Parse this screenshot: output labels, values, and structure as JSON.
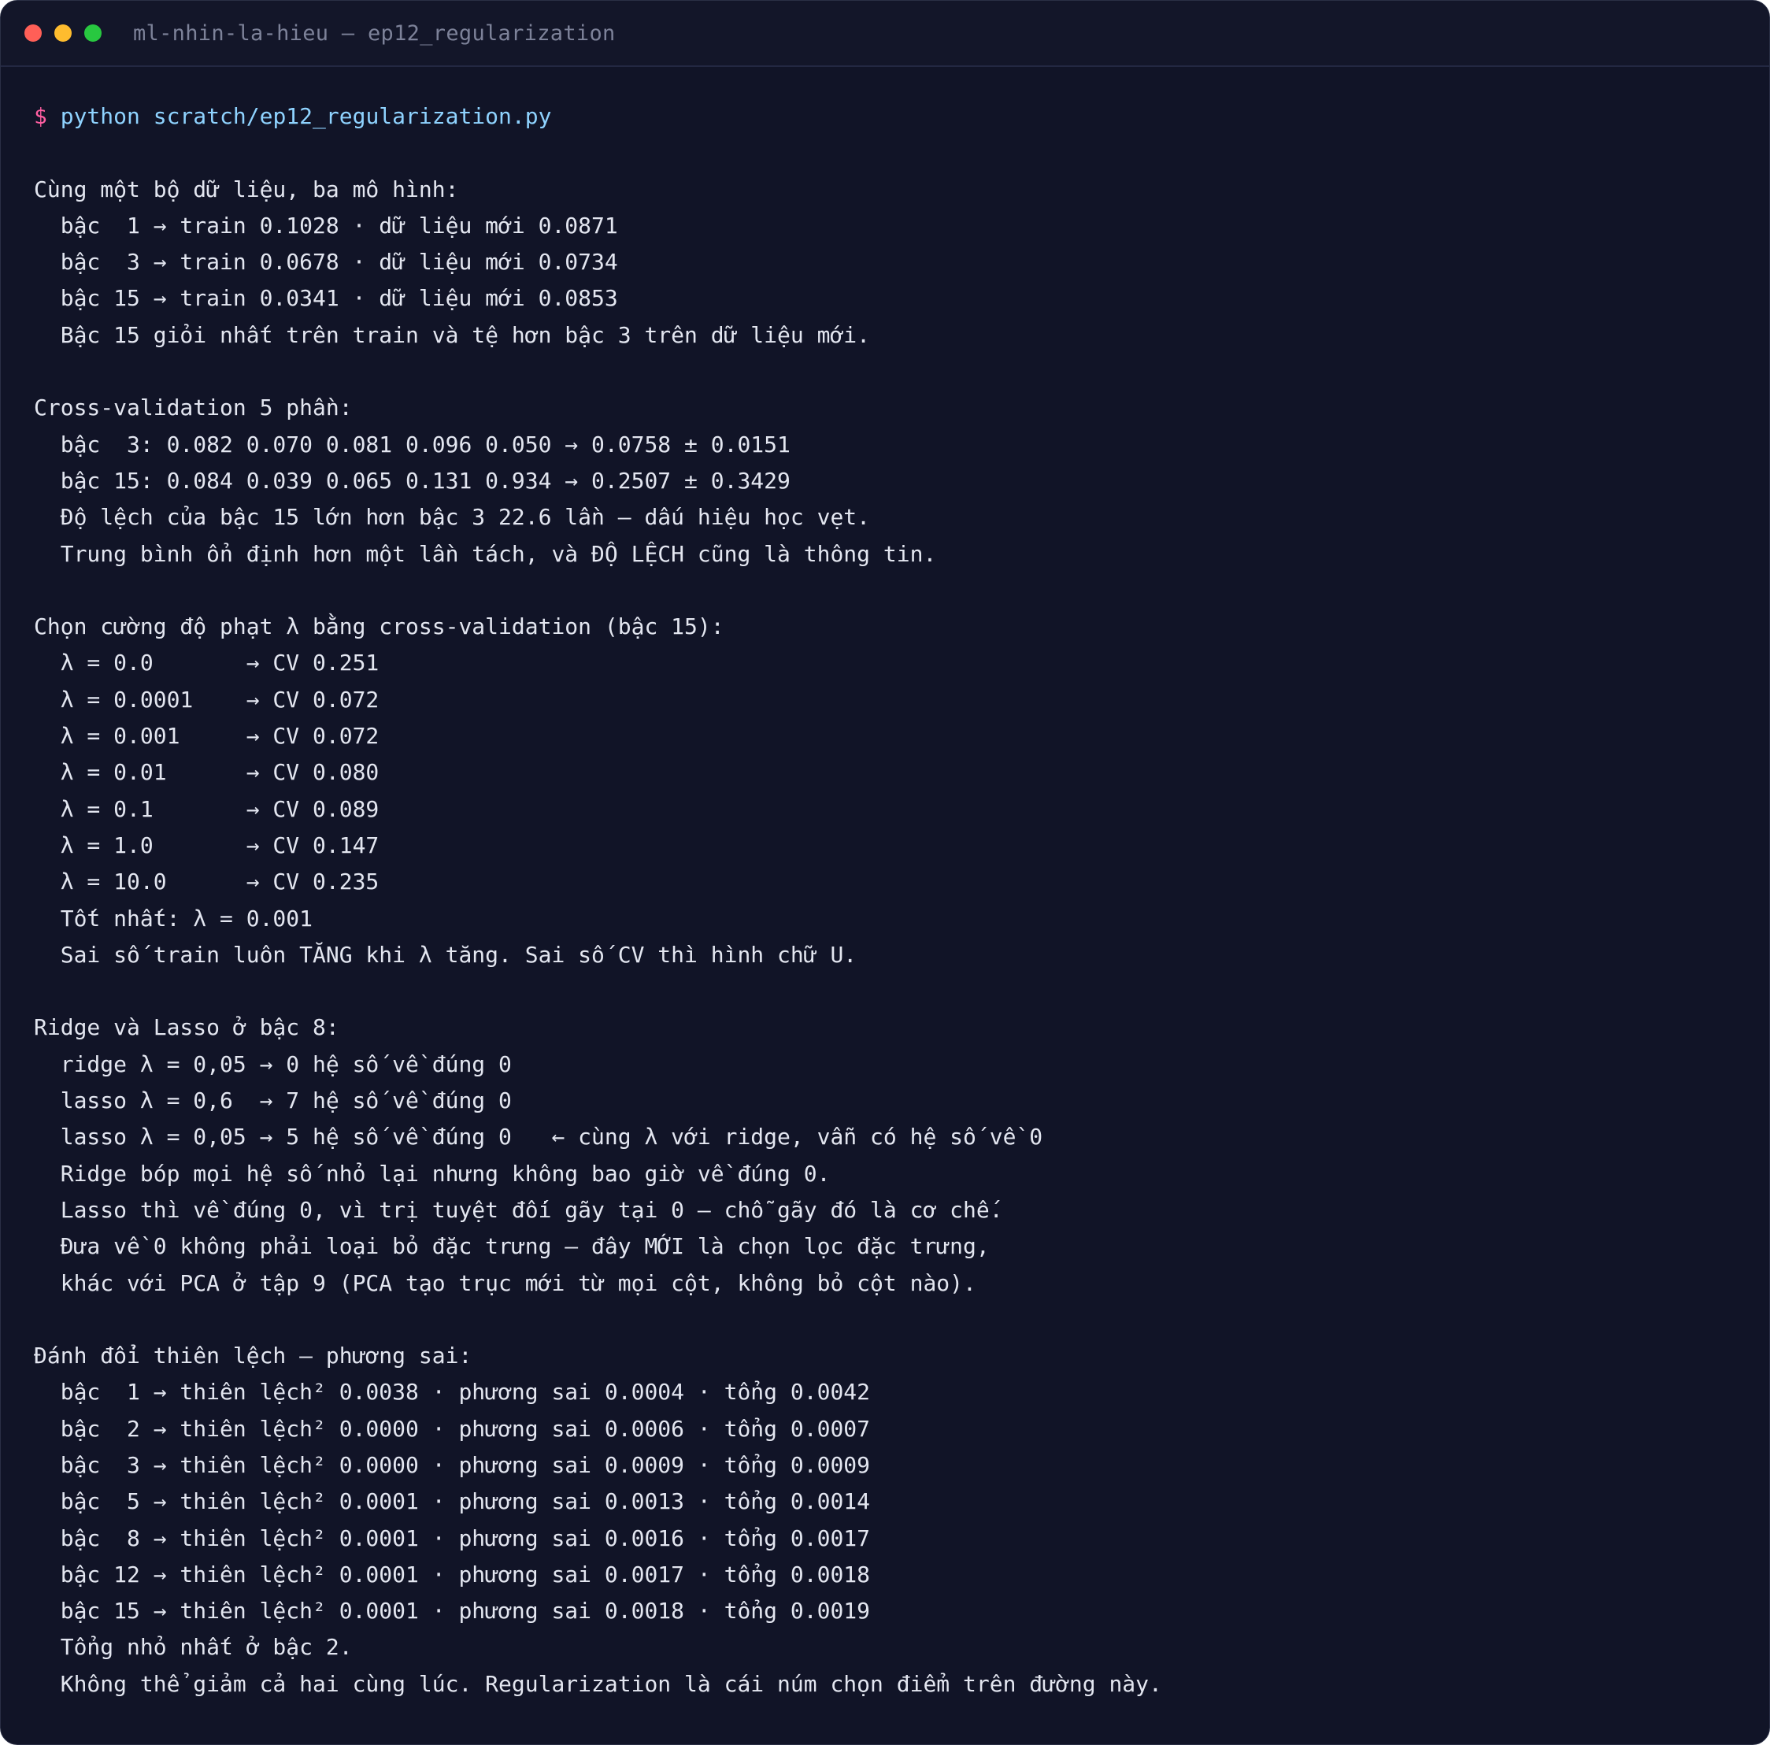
{
  "window": {
    "title": "ml-nhin-la-hieu — ep12_regularization"
  },
  "terminal": {
    "prompt_symbol": "$",
    "command": "python scratch/ep12_regularization.py",
    "sections": [
      {
        "lines": [
          "Cùng một bộ dữ liệu, ba mô hình:",
          "  bậc  1 → train 0.1028 · dữ liệu mới 0.0871",
          "  bậc  3 → train 0.0678 · dữ liệu mới 0.0734",
          "  bậc 15 → train 0.0341 · dữ liệu mới 0.0853",
          "  Bậc 15 giỏi nhất trên train và tệ hơn bậc 3 trên dữ liệu mới."
        ]
      },
      {
        "lines": [
          "Cross-validation 5 phần:",
          "  bậc  3: 0.082 0.070 0.081 0.096 0.050 → 0.0758 ± 0.0151",
          "  bậc 15: 0.084 0.039 0.065 0.131 0.934 → 0.2507 ± 0.3429",
          "  Độ lệch của bậc 15 lớn hơn bậc 3 22.6 lần — dấu hiệu học vẹt.",
          "  Trung bình ổn định hơn một lần tách, và ĐỘ LỆCH cũng là thông tin."
        ]
      },
      {
        "lines": [
          "Chọn cường độ phạt λ bằng cross-validation (bậc 15):",
          "  λ = 0.0       → CV 0.251",
          "  λ = 0.0001    → CV 0.072",
          "  λ = 0.001     → CV 0.072",
          "  λ = 0.01      → CV 0.080",
          "  λ = 0.1       → CV 0.089",
          "  λ = 1.0       → CV 0.147",
          "  λ = 10.0      → CV 0.235",
          "  Tốt nhất: λ = 0.001",
          "  Sai số train luôn TĂNG khi λ tăng. Sai số CV thì hình chữ U."
        ]
      },
      {
        "lines": [
          "Ridge và Lasso ở bậc 8:",
          "  ridge λ = 0,05 → 0 hệ số về đúng 0",
          "  lasso λ = 0,6  → 7 hệ số về đúng 0",
          "  lasso λ = 0,05 → 5 hệ số về đúng 0   ← cùng λ với ridge, vẫn có hệ số về 0",
          "  Ridge bóp mọi hệ số nhỏ lại nhưng không bao giờ về đúng 0.",
          "  Lasso thì về đúng 0, vì trị tuyệt đối gãy tại 0 — chỗ gãy đó là cơ chế.",
          "  Đưa về 0 không phải loại bỏ đặc trưng — đây MỚI là chọn lọc đặc trưng,",
          "  khác với PCA ở tập 9 (PCA tạo trục mới từ mọi cột, không bỏ cột nào)."
        ]
      },
      {
        "lines": [
          "Đánh đổi thiên lệch — phương sai:",
          "  bậc  1 → thiên lệch² 0.0038 · phương sai 0.0004 · tổng 0.0042",
          "  bậc  2 → thiên lệch² 0.0000 · phương sai 0.0006 · tổng 0.0007",
          "  bậc  3 → thiên lệch² 0.0000 · phương sai 0.0009 · tổng 0.0009",
          "  bậc  5 → thiên lệch² 0.0001 · phương sai 0.0013 · tổng 0.0014",
          "  bậc  8 → thiên lệch² 0.0001 · phương sai 0.0016 · tổng 0.0017",
          "  bậc 12 → thiên lệch² 0.0001 · phương sai 0.0017 · tổng 0.0018",
          "  bậc 15 → thiên lệch² 0.0001 · phương sai 0.0018 · tổng 0.0019",
          "  Tổng nhỏ nhất ở bậc 2.",
          "  Không thể giảm cả hai cùng lúc. Regularization là cái núm chọn điểm trên đường này."
        ]
      }
    ]
  }
}
